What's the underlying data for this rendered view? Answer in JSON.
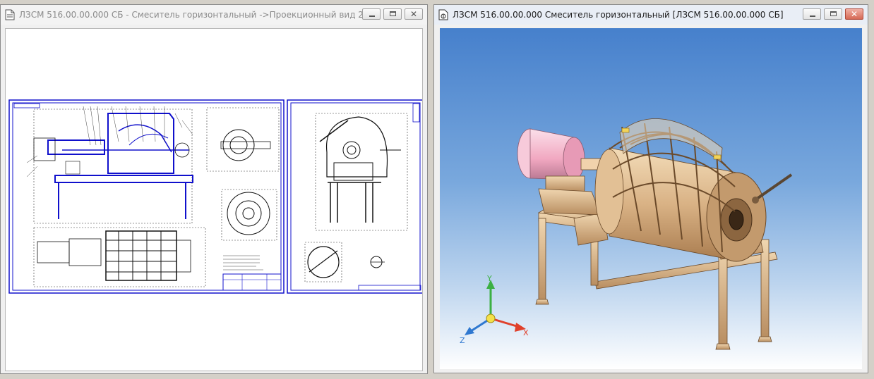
{
  "left_window": {
    "title": "ЛЗСМ 516.00.00.000 СБ - Смеситель горизонтальный ->Проекционный вид 2",
    "icon": "drawing-document-icon",
    "controls": {
      "minimize": "minimize-icon",
      "maximize": "maximize-icon",
      "close": "close-icon",
      "close_glyph": "✕"
    }
  },
  "right_window": {
    "title": "ЛЗСМ 516.00.00.000 Смеситель горизонтальный [ЛЗСМ 516.00.00.000 СБ]",
    "icon": "assembly-document-icon",
    "controls": {
      "minimize": "minimize-icon",
      "maximize": "maximize-icon",
      "close": "close-icon",
      "close_glyph": "✕"
    }
  },
  "triad": {
    "x_label": "X",
    "y_label": "Y",
    "z_label": "Z"
  },
  "colors": {
    "drawing_frame": "#1010cc",
    "drawing_lines": "#111111",
    "model_body": "#e8c9a0",
    "motor": "#f4b6c8",
    "axis_x": "#e0402a",
    "axis_y": "#3cb043",
    "axis_z": "#2f78d0",
    "viewport_top": "#4680cc"
  }
}
